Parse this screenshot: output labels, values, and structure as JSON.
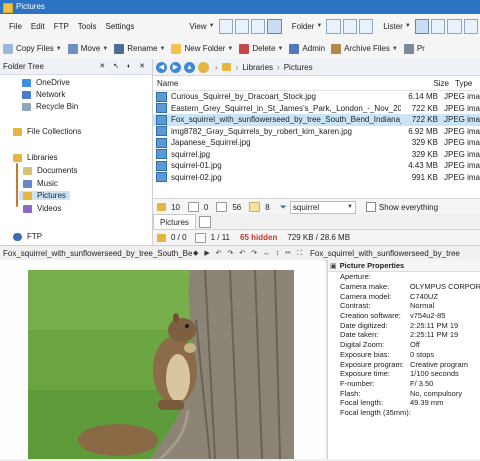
{
  "window": {
    "title": "Pictures"
  },
  "menu": [
    "File",
    "Edit",
    "FTP",
    "Tools",
    "Settings"
  ],
  "view_menu": {
    "view": "View",
    "folder": "Folder",
    "lister": "Lister"
  },
  "toolbar": {
    "copy_files": "Copy Files",
    "move": "Move",
    "rename": "Rename",
    "new_folder": "New Folder",
    "delete": "Delete",
    "admin": "Admin",
    "archive_files": "Archive Files",
    "pr": "Pr"
  },
  "tree": {
    "header": "Folder Tree",
    "items": [
      {
        "label": "OneDrive",
        "color": "#3d8fe0"
      },
      {
        "label": "Network",
        "color": "#4a7cc9"
      },
      {
        "label": "Recycle Bin",
        "color": "#8fa6bf"
      },
      {
        "label": "File Collections",
        "color": "#e4b640"
      },
      {
        "label": "Libraries",
        "color": "#e4b640"
      },
      {
        "label": "Documents",
        "color": "#d8c17a"
      },
      {
        "label": "Music",
        "color": "#6b87c8"
      },
      {
        "label": "Pictures",
        "color": "#e4b640"
      },
      {
        "label": "Videos",
        "color": "#8c6bc8"
      }
    ],
    "ftp": "FTP"
  },
  "breadcrumb": [
    "Libraries",
    "Pictures"
  ],
  "columns": {
    "name": "Name",
    "size": "Size",
    "type": "Type"
  },
  "files": [
    {
      "name": "Curious_Squirrel_by_Dracoart_Stock.jpg",
      "size": "6.14 MB",
      "type": "JPEG ima"
    },
    {
      "name": "Eastern_Grey_Squirrel_in_St_James's_Park,_London_-_Nov_2006.jpg",
      "size": "722 KB",
      "type": "JPEG ima"
    },
    {
      "name": "Fox_squirrel_with_sunflowerseed_by_tree_South_Bend_Indiana_USA.jpg",
      "size": "722 KB",
      "type": "JPEG ima"
    },
    {
      "name": "img8782_Gray_Squirrels_by_robert_kim_karen.jpg",
      "size": "6.92 MB",
      "type": "JPEG ima"
    },
    {
      "name": "Japanese_Squirrel.jpg",
      "size": "329 KB",
      "type": "JPEG ima"
    },
    {
      "name": "squirrel.jpg",
      "size": "329 KB",
      "type": "JPEG ima"
    },
    {
      "name": "squirrel-01.jpg",
      "size": "4.43 MB",
      "type": "JPEG ima"
    },
    {
      "name": "squirrel-02.jpg",
      "size": "991 KB",
      "type": "JPEG ima"
    }
  ],
  "filter": {
    "c1": "10",
    "c2": "0",
    "c3": "56",
    "c4": "8",
    "text": "squirrel",
    "show_everything": "Show everything"
  },
  "tab": "Pictures",
  "status": {
    "folders": "0 / 0",
    "files": "1 / 11",
    "hidden": "65 hidden",
    "sizes": "729 KB / 28.6 MB"
  },
  "preview": {
    "filename_left": "Fox_squirrel_with_sunflowerseed_by_tree_South_Bend_I...",
    "filename_right": "Fox_squirrel_with_sunflowerseed_by_tree_South_Bend_Indiana_USA.jpg"
  },
  "properties": {
    "header": "Picture Properties",
    "rows": [
      {
        "k": "Aperture:",
        "v": ""
      },
      {
        "k": "Camera make:",
        "v": "OLYMPUS CORPOR"
      },
      {
        "k": "Camera model:",
        "v": "C740UZ"
      },
      {
        "k": "Contrast:",
        "v": "Normal"
      },
      {
        "k": "Creation software:",
        "v": "v754u2-85"
      },
      {
        "k": "Date digitized:",
        "v": "2:25:11 PM      19"
      },
      {
        "k": "Date taken:",
        "v": "2:25:11 PM      19"
      },
      {
        "k": "Digital Zoom:",
        "v": "Off"
      },
      {
        "k": "Exposure bias:",
        "v": "0      stops"
      },
      {
        "k": "Exposure program:",
        "v": "Creative program"
      },
      {
        "k": "Exposure time:",
        "v": "1/100      seconds"
      },
      {
        "k": "F-number:",
        "v": "F/  3.50"
      },
      {
        "k": "Flash:",
        "v": "No, compulsory"
      },
      {
        "k": "Focal length:",
        "v": "49.39      mm"
      },
      {
        "k": "Focal length (35mm):",
        "v": ""
      }
    ]
  }
}
